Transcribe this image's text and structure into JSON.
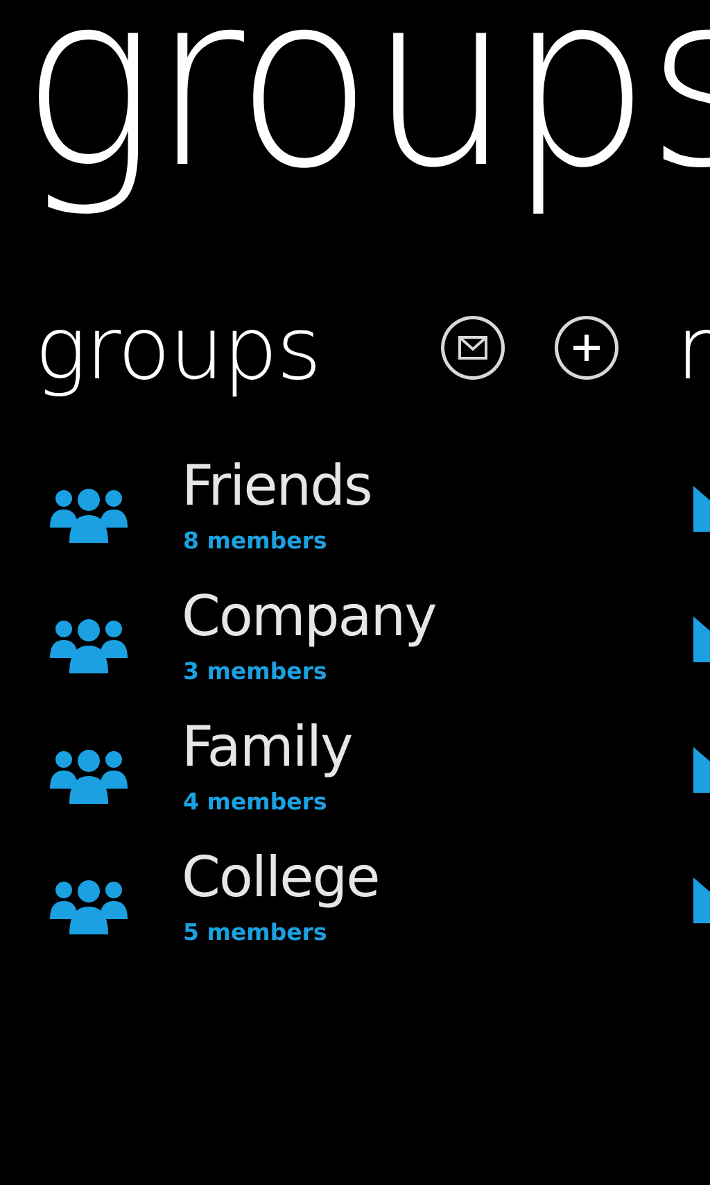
{
  "hub": {
    "title": "groups"
  },
  "section": {
    "title": "groups",
    "next_peek": "m"
  },
  "actions": {
    "mail_icon": "envelope-icon",
    "add_icon": "plus-icon"
  },
  "groups": [
    {
      "name": "Friends",
      "count": "8 members"
    },
    {
      "name": "Company",
      "count": "3 members"
    },
    {
      "name": "Family",
      "count": "4 members"
    },
    {
      "name": "College",
      "count": "5 members"
    }
  ],
  "colors": {
    "background": "#000000",
    "accent": "#1ba1e2",
    "text": "#e6e6e6"
  }
}
